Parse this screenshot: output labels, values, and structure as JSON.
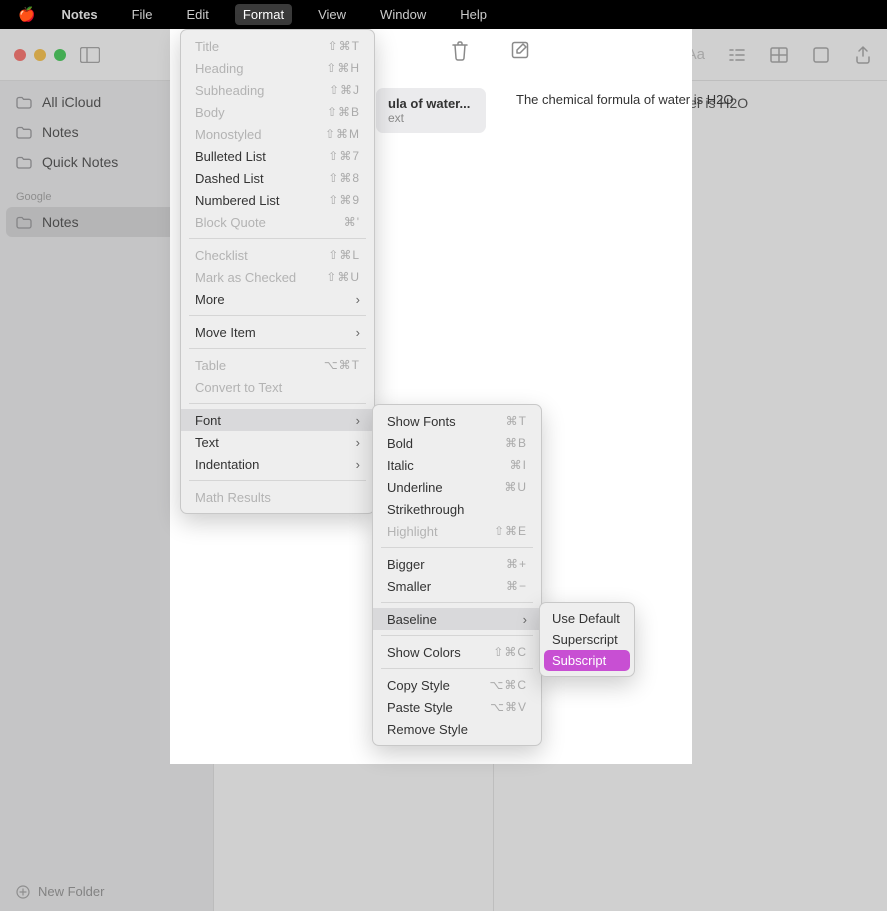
{
  "menubar": {
    "app": "Notes",
    "items": [
      "File",
      "Edit",
      "Format",
      "View",
      "Window",
      "Help"
    ],
    "active": "Format"
  },
  "sidebar": {
    "items": [
      {
        "label": "All iCloud"
      },
      {
        "label": "Notes"
      },
      {
        "label": "Quick Notes"
      }
    ],
    "section2_title": "Google",
    "section2_items": [
      {
        "label": "Notes",
        "selected": true
      }
    ],
    "new_folder": "New Folder"
  },
  "noteslist": {
    "card": {
      "title": "ula of water...",
      "sub": "ext"
    }
  },
  "editor": {
    "text": "The chemical formula of water is H2O"
  },
  "menus": {
    "format": [
      {
        "t": "Title",
        "kb": "⇧⌘T",
        "disabled": true
      },
      {
        "t": "Heading",
        "kb": "⇧⌘H",
        "disabled": true
      },
      {
        "t": "Subheading",
        "kb": "⇧⌘J",
        "disabled": true
      },
      {
        "t": "Body",
        "kb": "⇧⌘B",
        "disabled": true
      },
      {
        "t": "Monostyled",
        "kb": "⇧⌘M",
        "disabled": true
      },
      {
        "t": "Bulleted List",
        "kb": "⇧⌘7"
      },
      {
        "t": "Dashed List",
        "kb": "⇧⌘8"
      },
      {
        "t": "Numbered List",
        "kb": "⇧⌘9"
      },
      {
        "t": "Block Quote",
        "kb": "⌘'",
        "disabled": true
      },
      {
        "sep": true
      },
      {
        "t": "Checklist",
        "kb": "⇧⌘L",
        "disabled": true
      },
      {
        "t": "Mark as Checked",
        "kb": "⇧⌘U",
        "disabled": true
      },
      {
        "t": "More",
        "arrow": true
      },
      {
        "sep": true
      },
      {
        "t": "Move Item",
        "arrow": true
      },
      {
        "sep": true
      },
      {
        "t": "Table",
        "kb": "⌥⌘T",
        "disabled": true
      },
      {
        "t": "Convert to Text",
        "disabled": true
      },
      {
        "sep": true
      },
      {
        "t": "Font",
        "arrow": true,
        "hover": true
      },
      {
        "t": "Text",
        "arrow": true
      },
      {
        "t": "Indentation",
        "arrow": true
      },
      {
        "sep": true
      },
      {
        "t": "Math Results",
        "disabled": true
      }
    ],
    "font": [
      {
        "t": "Show Fonts",
        "kb": "⌘T"
      },
      {
        "t": "Bold",
        "kb": "⌘B"
      },
      {
        "t": "Italic",
        "kb": "⌘I"
      },
      {
        "t": "Underline",
        "kb": "⌘U"
      },
      {
        "t": "Strikethrough"
      },
      {
        "t": "Highlight",
        "kb": "⇧⌘E",
        "disabled": true
      },
      {
        "sep": true
      },
      {
        "t": "Bigger",
        "kb": "⌘+"
      },
      {
        "t": "Smaller",
        "kb": "⌘−"
      },
      {
        "sep": true
      },
      {
        "t": "Baseline",
        "arrow": true,
        "hover": true
      },
      {
        "sep": true
      },
      {
        "t": "Show Colors",
        "kb": "⇧⌘C"
      },
      {
        "sep": true
      },
      {
        "t": "Copy Style",
        "kb": "⌥⌘C"
      },
      {
        "t": "Paste Style",
        "kb": "⌥⌘V"
      },
      {
        "t": "Remove Style"
      }
    ],
    "baseline": [
      {
        "t": "Use Default"
      },
      {
        "t": "Superscript"
      },
      {
        "t": "Subscript",
        "highlight": true
      }
    ]
  }
}
